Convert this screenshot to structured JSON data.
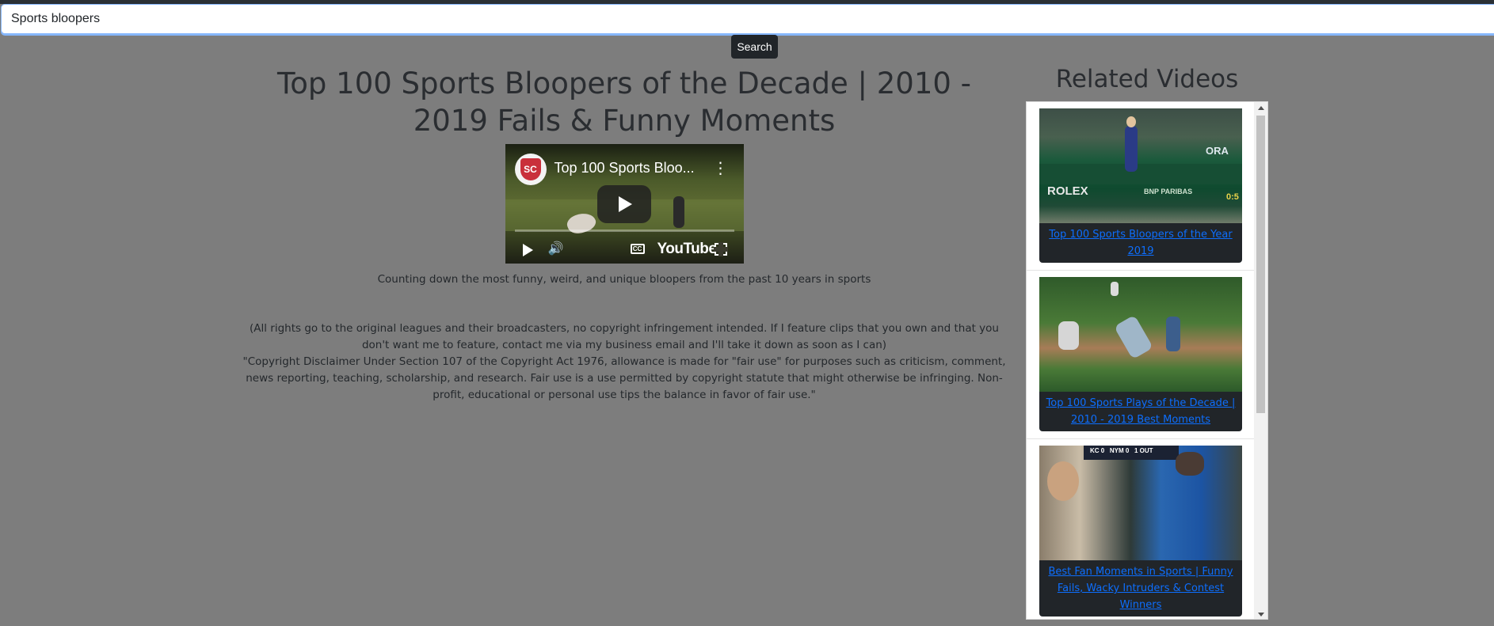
{
  "search": {
    "value": "Sports bloopers",
    "button_label": "Search"
  },
  "video": {
    "title": "Top 100 Sports Bloopers of the Decade | 2010 - 2019 Fails & Funny Moments",
    "player": {
      "title": "Top 100 Sports Bloo...",
      "channel_logo_text": "SC",
      "brand": "YouTube"
    },
    "description_short": "Counting down the most funny, weird, and unique bloopers from the past 10 years in sports",
    "description_rights": "(All rights go to the original leagues and their broadcasters, no copyright infringement intended. If I feature clips that you own and that you don't want me to feature, contact me via my business email and I'll take it down as soon as I can)",
    "description_disclaimer": "\"Copyright Disclaimer Under Section 107 of the Copyright Act 1976, allowance is made for \"fair use\" for purposes such as criticism, comment, news reporting, teaching, scholarship, and research. Fair use is a use permitted by copyright statute that might otherwise be infringing. Non-profit, educational or personal use tips the balance in favor of fair use.\""
  },
  "related": {
    "heading": "Related Videos",
    "items": [
      {
        "title": "Top 100 Sports Bloopers of the Year 2019",
        "thumb": "tennis-court"
      },
      {
        "title": "Top 100 Sports Plays of the Decade | 2010 - 2019 Best Moments",
        "thumb": "baseball-field"
      },
      {
        "title": "Best Fan Moments in Sports | Funny Fails, Wacky Intruders & Contest Winners",
        "thumb": "stadium-fans"
      }
    ]
  },
  "icons": {
    "play": "play-icon",
    "volume": "volume-icon",
    "captions": "captions-icon",
    "fullscreen": "fullscreen-icon",
    "menu": "kebab-menu-icon"
  },
  "colors": {
    "overlay_background": "#7d7d7d",
    "button_dark": "#212529",
    "link": "#0d6efd",
    "focus_border": "#86b7fe"
  }
}
